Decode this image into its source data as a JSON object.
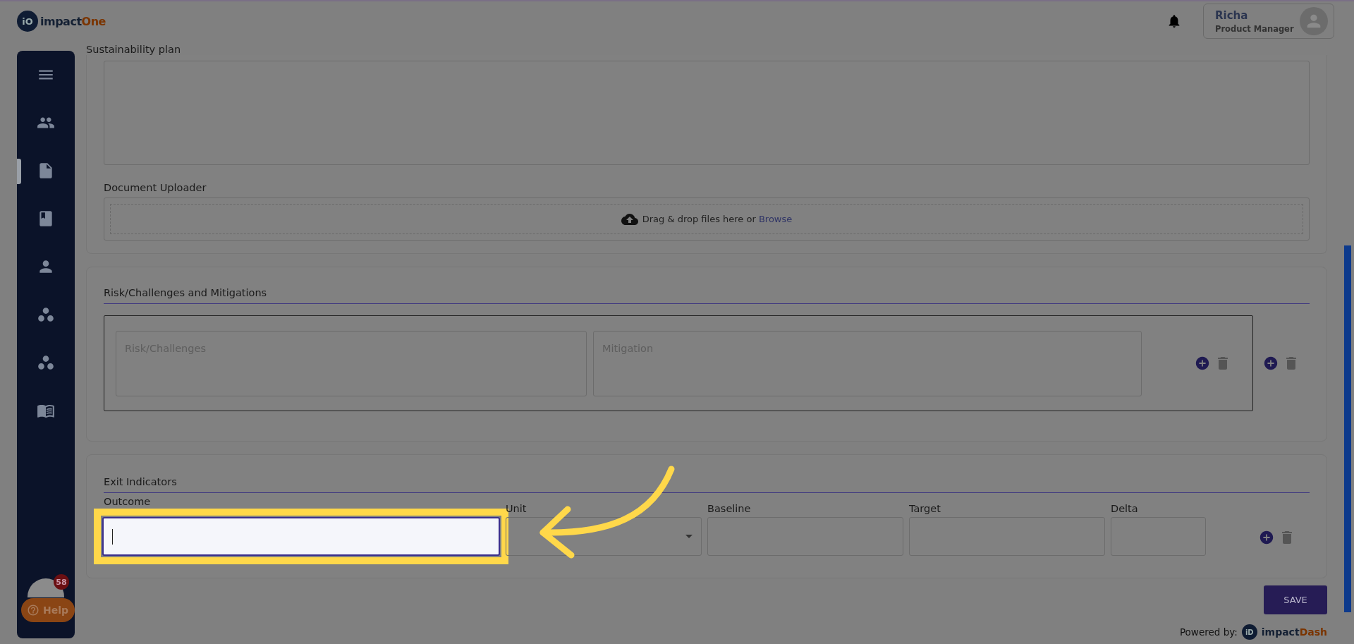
{
  "header": {
    "logo": {
      "mark": "iO",
      "name": "impact",
      "accent": "One"
    },
    "user": {
      "name": "Richa",
      "role": "Product Manager"
    }
  },
  "sidebar": {
    "items": [
      {
        "kind": "menu",
        "selected": false
      },
      {
        "kind": "people",
        "selected": false
      },
      {
        "kind": "document",
        "selected": true
      },
      {
        "kind": "book",
        "selected": false
      },
      {
        "kind": "person",
        "selected": false
      },
      {
        "kind": "hub",
        "selected": false
      },
      {
        "kind": "hub",
        "selected": false
      },
      {
        "kind": "reader",
        "selected": false
      }
    ],
    "badge": "58",
    "help": "Help"
  },
  "sustainability": {
    "label": "Sustainability plan"
  },
  "uploader": {
    "label": "Document Uploader",
    "prompt": "Drag & drop files here or",
    "link": "Browse"
  },
  "risks": {
    "title": "Risk/Challenges and Mitigations",
    "rows": [
      {
        "risk_placeholder": "Risk/Challenges",
        "mitigation_placeholder": "Mitigation"
      }
    ]
  },
  "exit": {
    "title": "Exit Indicators",
    "columns": [
      "Outcome",
      "Unit",
      "Baseline",
      "Target",
      "Delta"
    ],
    "outcome_focused": true
  },
  "save": "SAVE",
  "footer": {
    "powered": "Powered by:",
    "mark": "iD",
    "name": "impact",
    "accent": "Dash"
  }
}
